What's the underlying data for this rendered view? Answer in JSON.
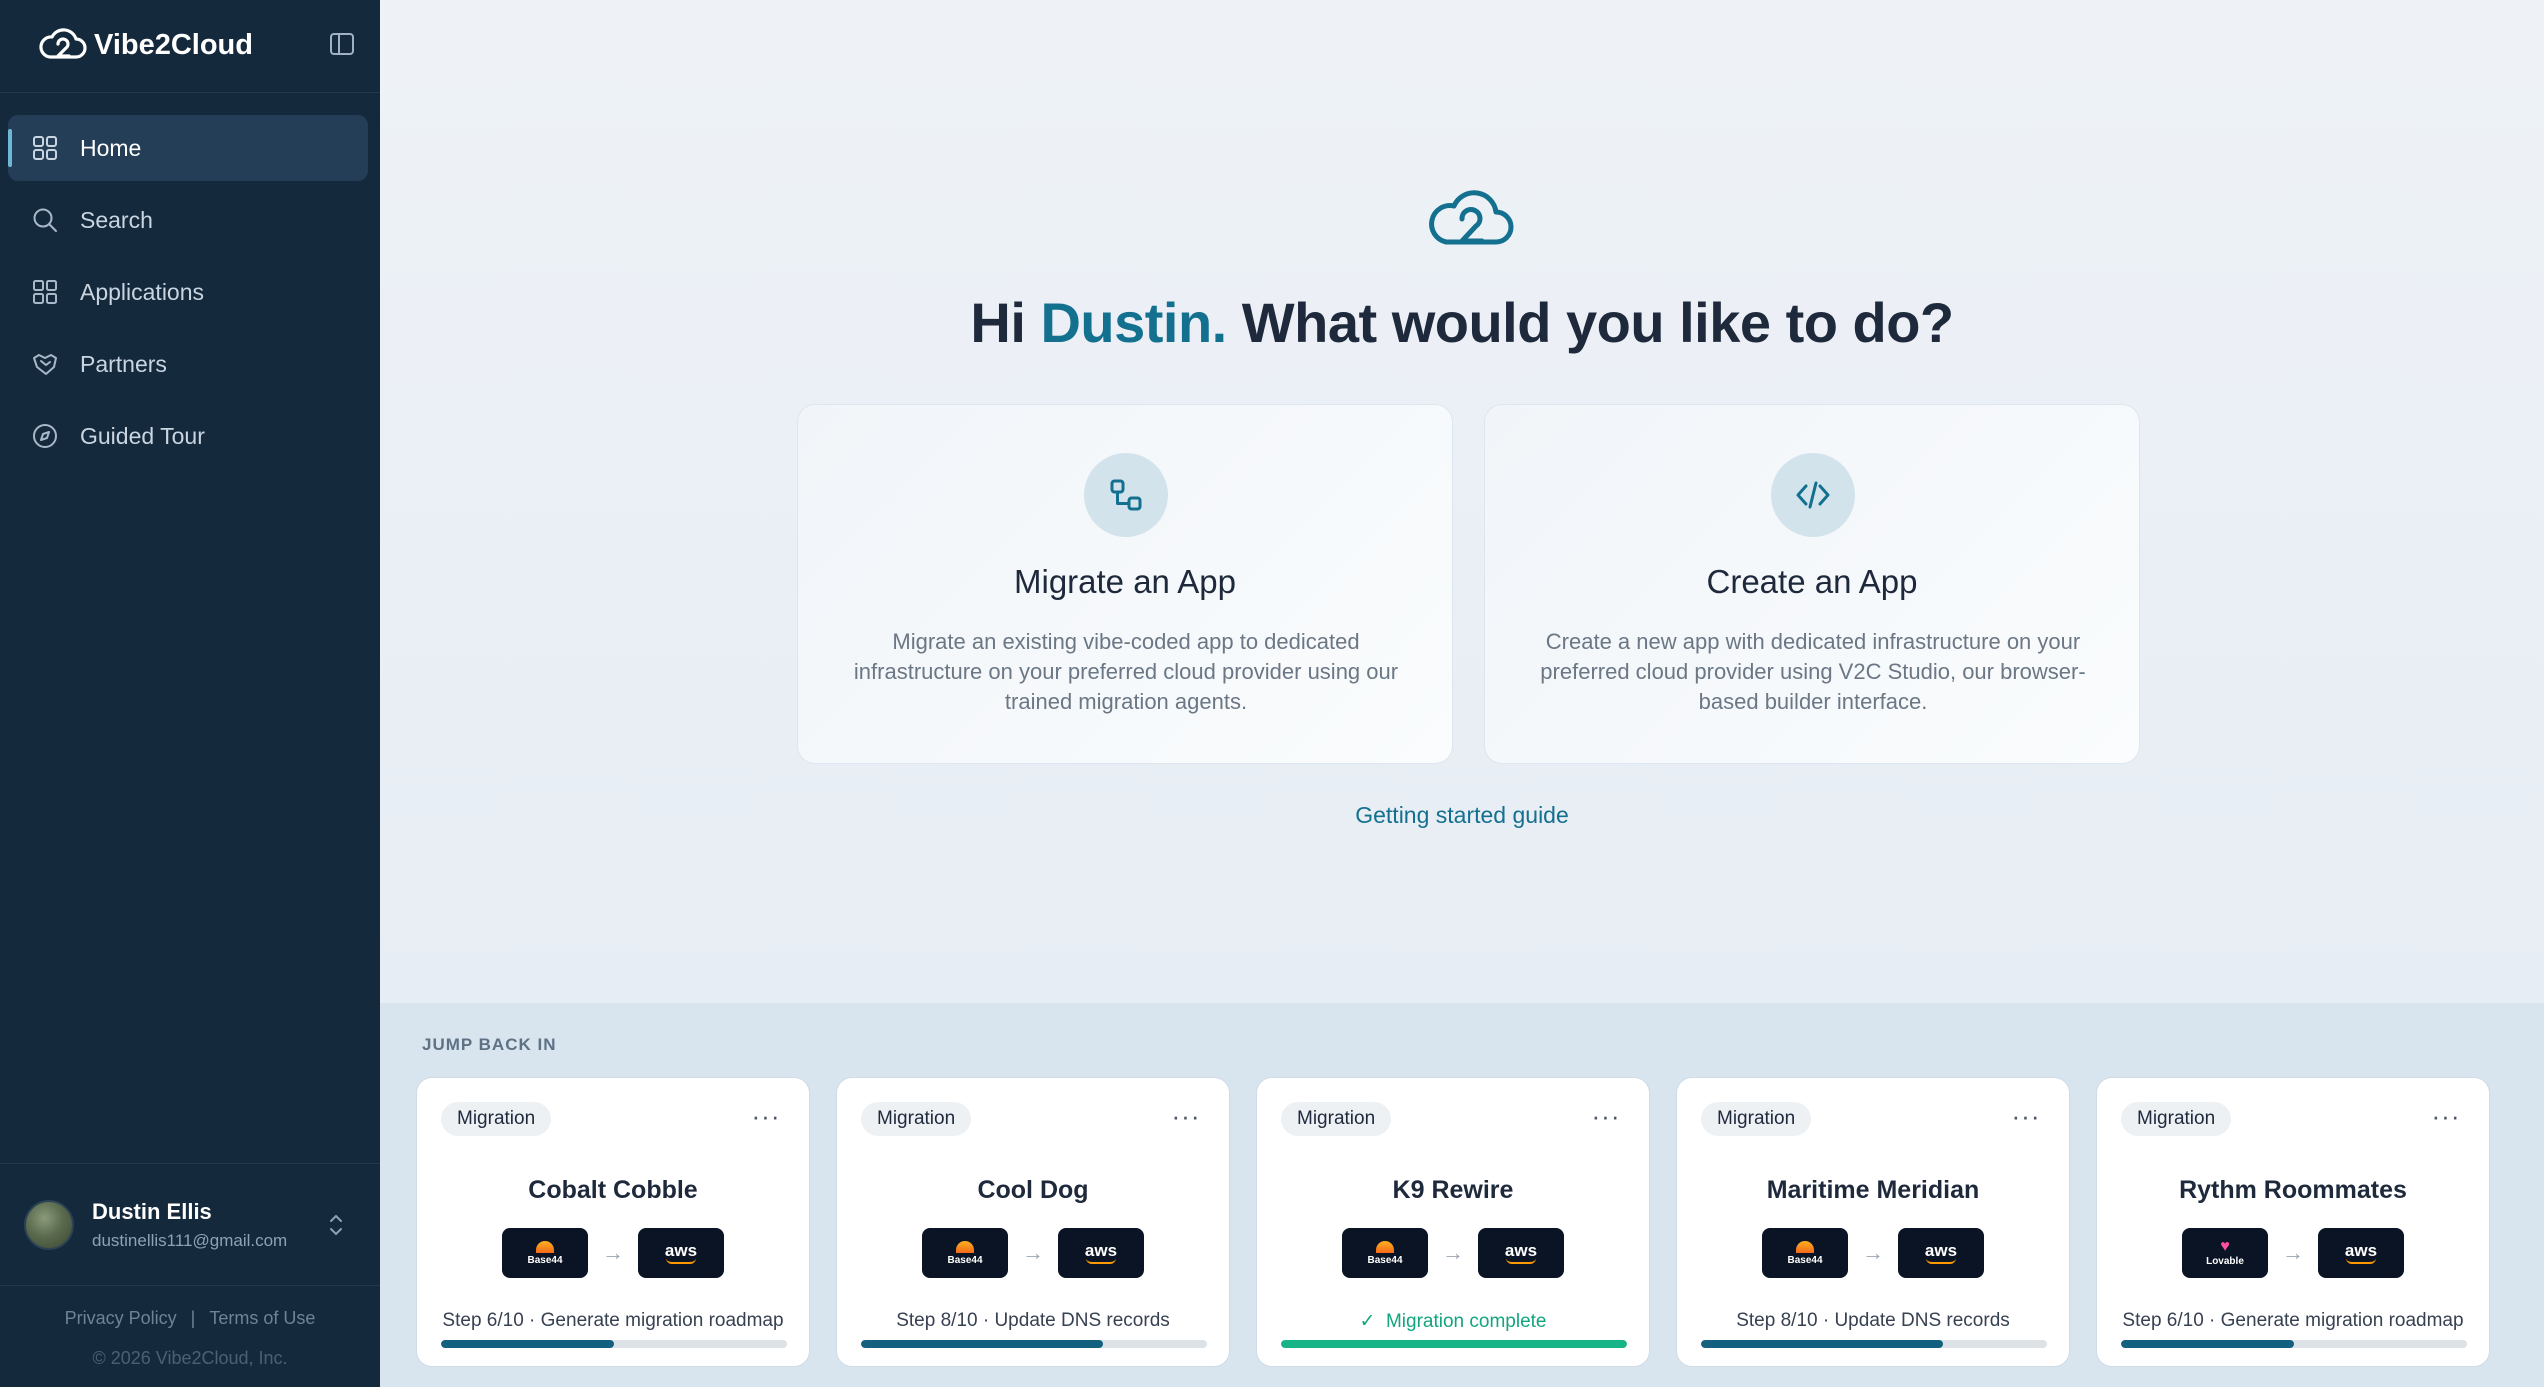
{
  "brand": {
    "name": "Vibe2Cloud"
  },
  "sidebar": {
    "items": [
      {
        "label": "Home",
        "icon": "grid-icon",
        "active": true
      },
      {
        "label": "Search",
        "icon": "search-icon"
      },
      {
        "label": "Applications",
        "icon": "apps-grid-icon"
      },
      {
        "label": "Partners",
        "icon": "handshake-icon"
      },
      {
        "label": "Guided Tour",
        "icon": "compass-icon"
      }
    ],
    "user": {
      "name": "Dustin Ellis",
      "email": "dustinellis111@gmail.com"
    },
    "legal": {
      "privacy": "Privacy Policy",
      "separator": "|",
      "terms": "Terms of Use"
    },
    "copyright": "© 2026 Vibe2Cloud, Inc."
  },
  "main": {
    "greeting": {
      "prefix": "Hi",
      "name": "Dustin.",
      "suffix": "What would you like to do?"
    },
    "cards": [
      {
        "title": "Migrate an App",
        "description": "Migrate an existing vibe-coded app to dedicated infrastructure on your preferred cloud provider using our trained migration agents.",
        "icon": "migrate-nodes-icon"
      },
      {
        "title": "Create an App",
        "description": "Create a new app with dedicated infrastructure on your preferred cloud provider using V2C Studio, our browser-based builder interface.",
        "icon": "code-icon"
      }
    ],
    "guide_link": "Getting started guide"
  },
  "jump": {
    "title": "JUMP BACK IN",
    "projects": [
      {
        "badge": "Migration",
        "title": "Cobalt Cobble",
        "source": "Base44",
        "target": "aws",
        "status": "Step 6/10 · Generate migration roadmap",
        "progress": 0.5,
        "complete": false
      },
      {
        "badge": "Migration",
        "title": "Cool Dog",
        "source": "Base44",
        "target": "aws",
        "status": "Step 8/10 · Update DNS records",
        "progress": 0.7,
        "complete": false
      },
      {
        "badge": "Migration",
        "title": "K9 Rewire",
        "source": "Base44",
        "target": "aws",
        "status": "Migration complete",
        "progress": 1.0,
        "complete": true
      },
      {
        "badge": "Migration",
        "title": "Maritime Meridian",
        "source": "Base44",
        "target": "aws",
        "status": "Step 8/10 · Update DNS records",
        "progress": 0.7,
        "complete": false
      },
      {
        "badge": "Migration",
        "title": "Rythm Roommates",
        "source": "Lovable",
        "target": "aws",
        "status": "Step 6/10 · Generate migration roadmap",
        "progress": 0.5,
        "complete": false
      }
    ]
  },
  "colors": {
    "sidebar_bg": "#15293c",
    "accent": "#13708f",
    "success": "#16b487",
    "progress": "#13607f"
  }
}
